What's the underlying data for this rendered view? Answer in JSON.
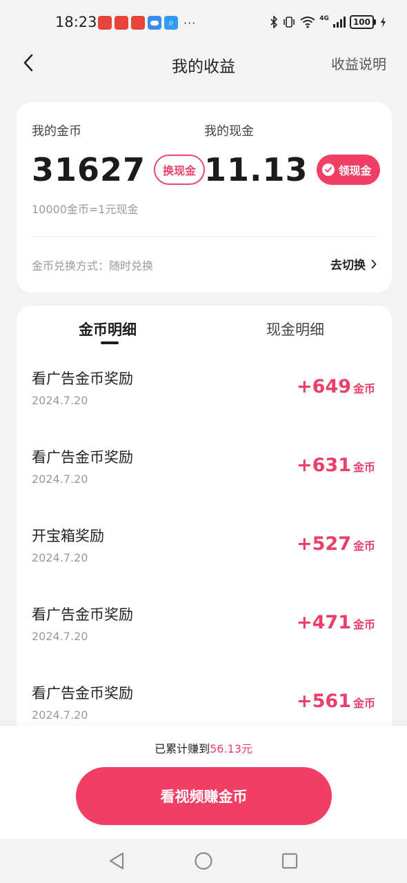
{
  "status_bar": {
    "time": "18:23",
    "more": "···",
    "network": "4G",
    "battery": "100"
  },
  "nav": {
    "title": "我的收益",
    "right_link": "收益说明"
  },
  "balance": {
    "coins_label": "我的金币",
    "coins_value": "31627",
    "exchange_button": "换现金",
    "cash_label": "我的现金",
    "cash_value": "11.13",
    "withdraw_button": "领现金",
    "rate_text": "10000金币=1元现金",
    "exchange_mode": "金币兑换方式：随时兑换",
    "switch_button": "去切换"
  },
  "tabs": [
    {
      "label": "金币明细",
      "active": true
    },
    {
      "label": "现金明细",
      "active": false
    }
  ],
  "records": [
    {
      "title": "看广告金币奖励",
      "date": "2024.7.20",
      "amount": "+649",
      "unit": "金币"
    },
    {
      "title": "看广告金币奖励",
      "date": "2024.7.20",
      "amount": "+631",
      "unit": "金币"
    },
    {
      "title": "开宝箱奖励",
      "date": "2024.7.20",
      "amount": "+527",
      "unit": "金币"
    },
    {
      "title": "看广告金币奖励",
      "date": "2024.7.20",
      "amount": "+471",
      "unit": "金币"
    },
    {
      "title": "看广告金币奖励",
      "date": "2024.7.20",
      "amount": "+561",
      "unit": "金币"
    }
  ],
  "footer": {
    "total_prefix": "已累计赚到",
    "total_amount": "56.13元",
    "cta": "看视频赚金币"
  },
  "colors": {
    "accent": "#f23d64",
    "accent_text": "#ea3f68",
    "background": "#f3f3f3"
  }
}
